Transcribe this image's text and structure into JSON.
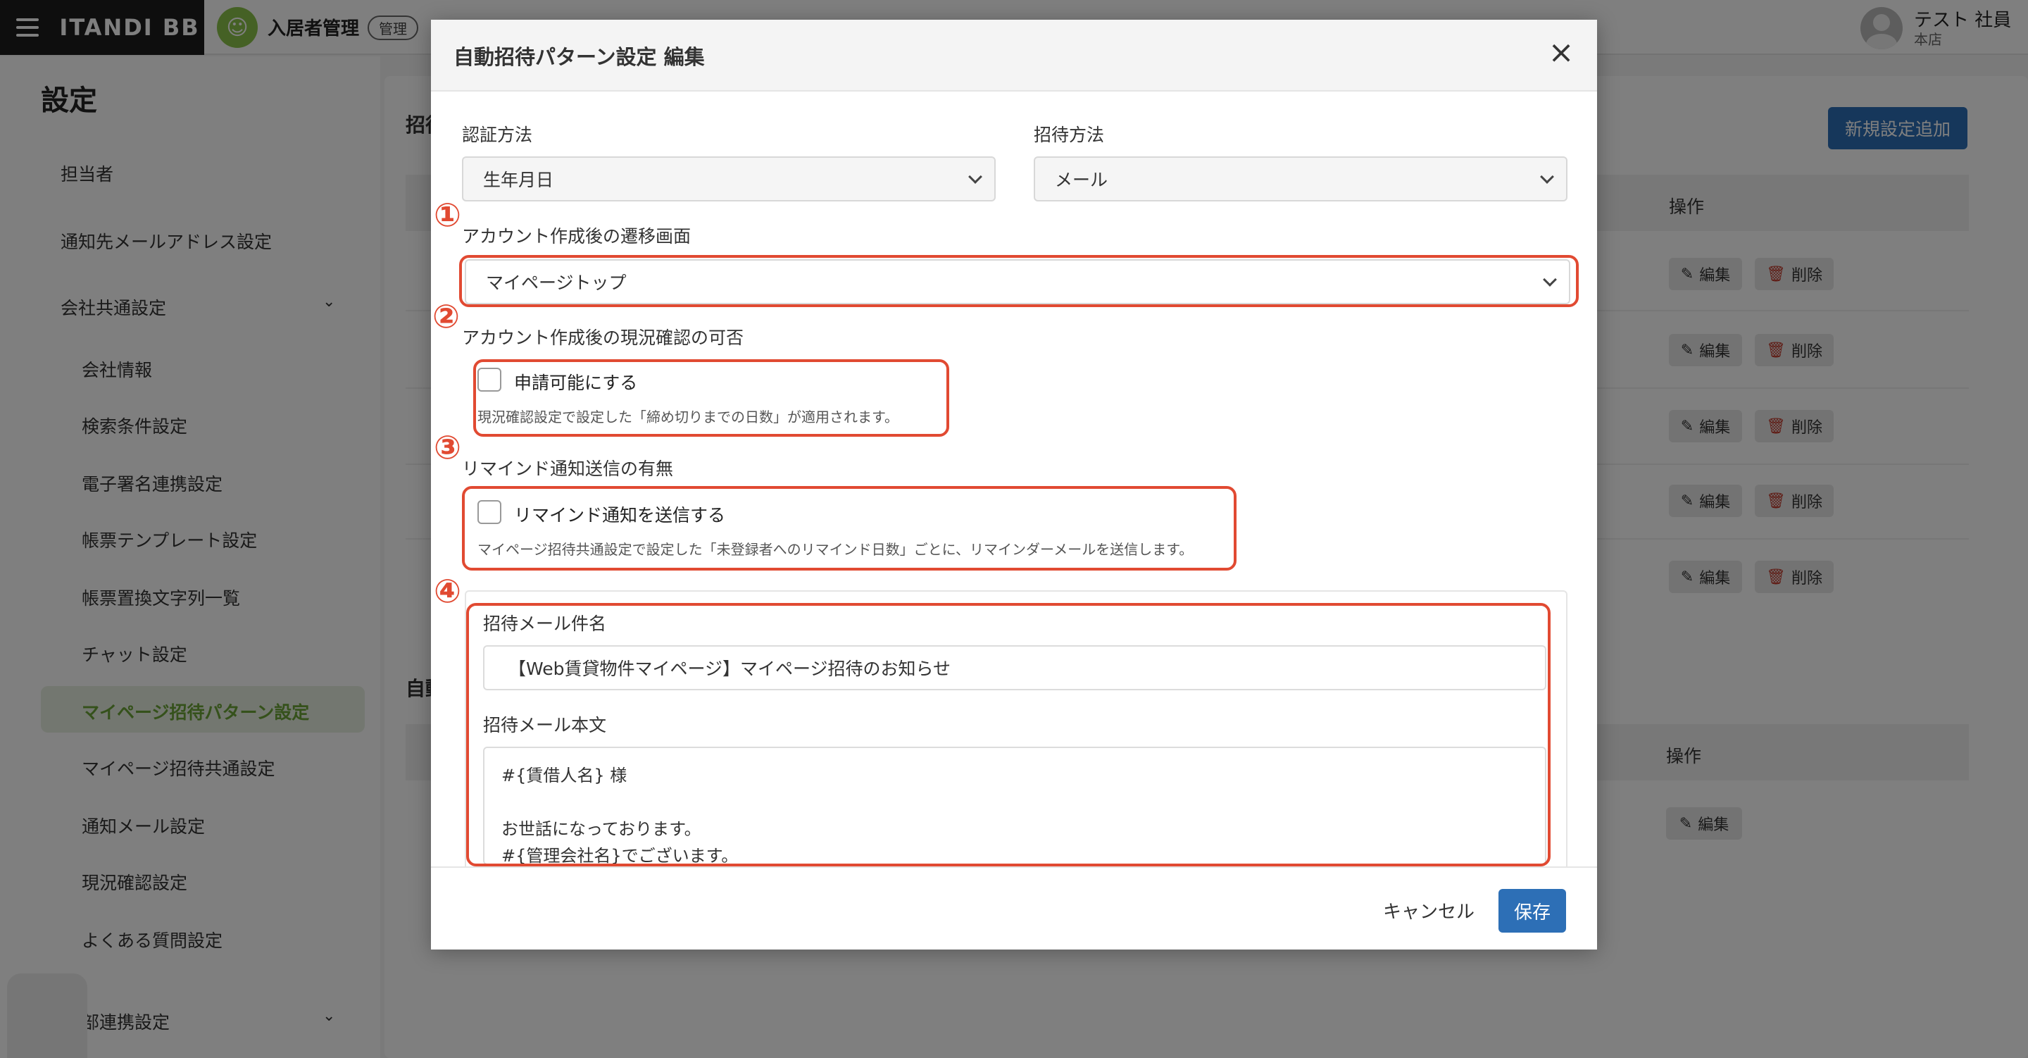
{
  "header": {
    "brand": "ITANDI BB",
    "app_name": "入居者管理",
    "admin_badge": "管理",
    "user_name": "テスト 社員",
    "user_branch": "本店"
  },
  "sidebar": {
    "title": "設定",
    "items": [
      {
        "label": "担当者"
      },
      {
        "label": "通知先メールアドレス設定"
      },
      {
        "label": "会社共通設定"
      },
      {
        "label": "会社情報"
      },
      {
        "label": "検索条件設定"
      },
      {
        "label": "電子署名連携設定"
      },
      {
        "label": "帳票テンプレート設定"
      },
      {
        "label": "帳票置換文字列一覧"
      },
      {
        "label": "チャット設定"
      },
      {
        "label": "マイページ招待パターン設定"
      },
      {
        "label": "マイページ招待共通設定"
      },
      {
        "label": "通知メール設定"
      },
      {
        "label": "現況確認設定"
      },
      {
        "label": "よくある質問設定"
      },
      {
        "label": "部連携設定"
      }
    ]
  },
  "main": {
    "section1_title": "招待",
    "section2_title": "自動",
    "new_button": "新規設定追加",
    "operation_header": "操作",
    "edit_label": "編集",
    "delete_label": "削除"
  },
  "modal": {
    "title": "自動招待パターン設定 編集",
    "auth_method_label": "認証方法",
    "auth_method_value": "生年月日",
    "invite_method_label": "招待方法",
    "invite_method_value": "メール",
    "redirect_label": "アカウント作成後の遷移画面",
    "redirect_value": "マイページトップ",
    "status_check_label": "アカウント作成後の現況確認の可否",
    "status_check_checkbox": "申請可能にする",
    "status_check_hint": "現況確認設定で設定した「締め切りまでの日数」が適用されます。",
    "remind_label": "リマインド通知送信の有無",
    "remind_checkbox": "リマインド通知を送信する",
    "remind_hint": "マイページ招待共通設定で設定した「未登録者へのリマインド日数」ごとに、リマインダーメールを送信します。",
    "mail_subject_label": "招待メール件名",
    "mail_subject_value": "【Web賃貸物件マイページ】マイページ招待のお知らせ",
    "mail_body_label": "招待メール本文",
    "mail_body_lines": [
      "#{賃借人名} 様",
      "",
      "お世話になっております。",
      "#{管理会社名}でございます。"
    ],
    "cancel": "キャンセル",
    "save": "保存",
    "annotations": [
      "①",
      "②",
      "③",
      "④"
    ]
  },
  "colors": {
    "accent": "#2d6fb6",
    "annotation_red": "#e14a32",
    "active_green": "#6aa236"
  }
}
